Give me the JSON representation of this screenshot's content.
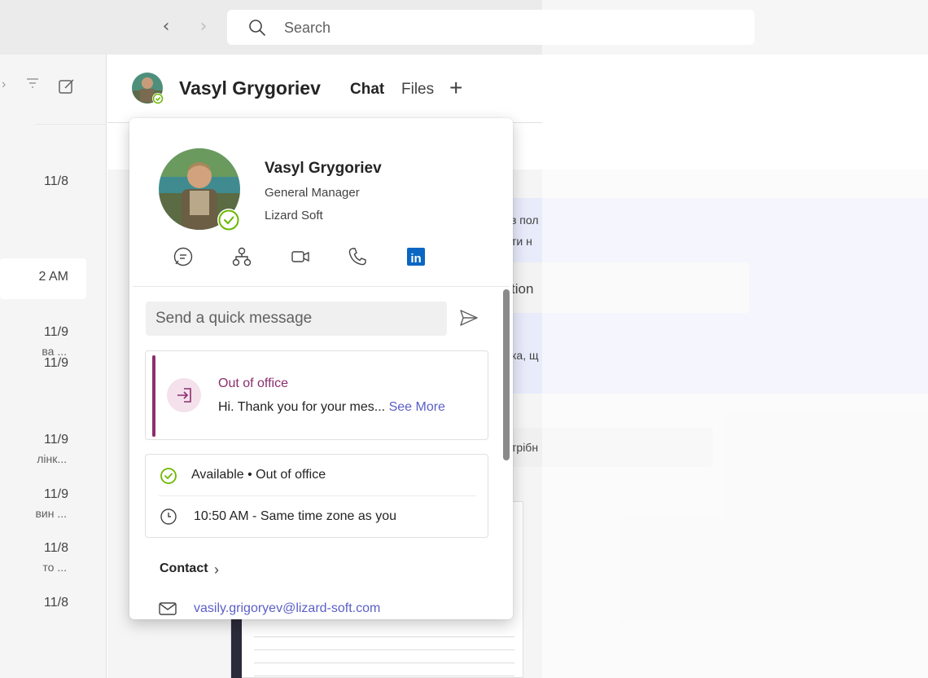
{
  "topbar": {
    "search_placeholder": "Search"
  },
  "chat_list": {
    "items": [
      {
        "date": "11/8",
        "snippet": ""
      },
      {
        "date": "2 AM",
        "snippet": ""
      },
      {
        "date": "11/9",
        "snippet": "ва ..."
      },
      {
        "date": "11/9",
        "snippet": ""
      },
      {
        "date": "11/9",
        "snippet": "лінк..."
      },
      {
        "date": "11/9",
        "snippet": "вин ..."
      },
      {
        "date": "11/8",
        "snippet": "то ..."
      },
      {
        "date": "11/8",
        "snippet": ""
      }
    ]
  },
  "chat_header": {
    "name": "Vasyl Grygoriev",
    "tab_chat": "Chat",
    "tab_files": "Files",
    "add_tab": "+"
  },
  "background_messages": {
    "line1": "з пол",
    "line2": "ти н",
    "file_name": "tion",
    "line3": "ка, щ",
    "line4": "трібн"
  },
  "profile_card": {
    "name": "Vasyl Grygoriev",
    "job_title": "General Manager",
    "company": "Lizard Soft",
    "actions": [
      "chat-icon",
      "org-chart-icon",
      "video-call-icon",
      "phone-icon",
      "linkedin-icon"
    ],
    "linkedin_label": "in",
    "quick_message_placeholder": "Send a quick message",
    "out_of_office": {
      "title": "Out of office",
      "message": "Hi. Thank you for your mes...",
      "see_more": "See More"
    },
    "availability": "Available • Out of office",
    "local_time": "10:50 AM - Same time zone as you",
    "contact_heading": "Contact",
    "email": "vasily.grigoryev@lizard-soft.com"
  },
  "colors": {
    "ooo_accent": "#8c2f6e",
    "available_green": "#6bb700",
    "link_blue": "#5b5fc7",
    "linkedin_blue": "#0a66c2"
  }
}
